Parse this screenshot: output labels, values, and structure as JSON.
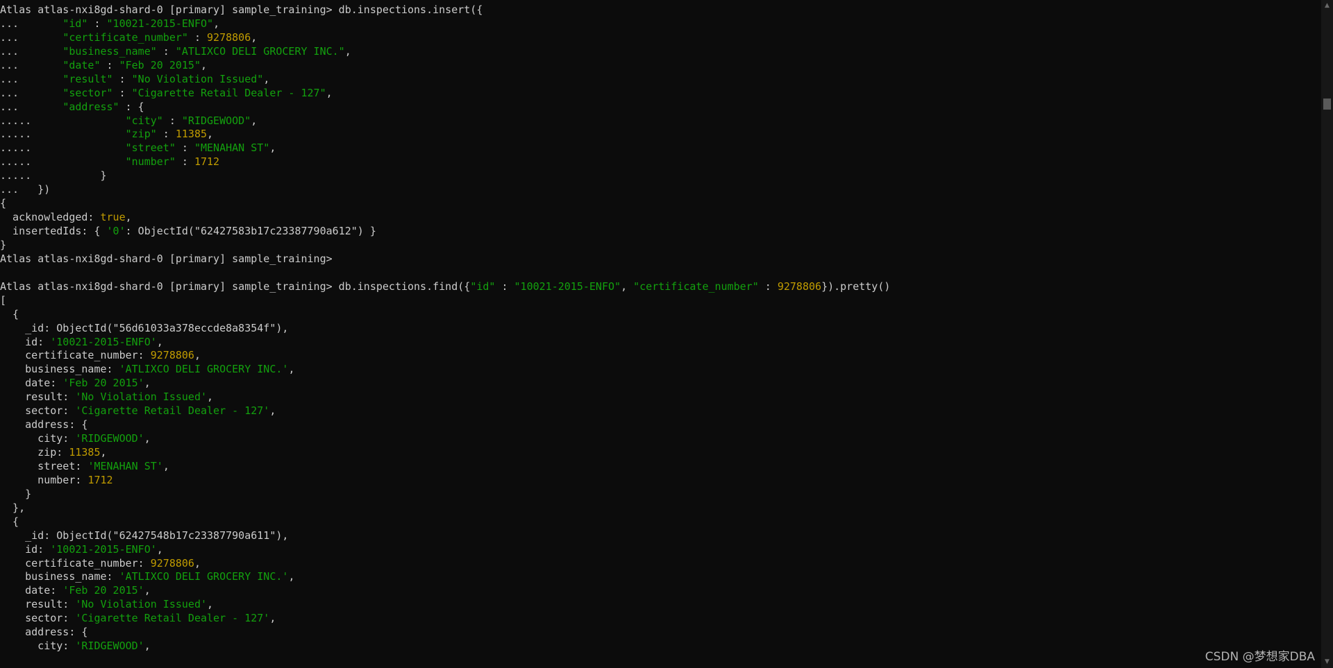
{
  "terminal": {
    "lines": [
      [
        {
          "t": "Atlas atlas-nxi8gd-shard-0 [primary] sample_training> db.inspections.insert({"
        }
      ],
      [
        {
          "t": "...       "
        },
        {
          "t": "\"id\"",
          "c": "s"
        },
        {
          "t": " : "
        },
        {
          "t": "\"10021-2015-ENFO\"",
          "c": "s"
        },
        {
          "t": ","
        }
      ],
      [
        {
          "t": "...       "
        },
        {
          "t": "\"certificate_number\"",
          "c": "s"
        },
        {
          "t": " : "
        },
        {
          "t": "9278806",
          "c": "n"
        },
        {
          "t": ","
        }
      ],
      [
        {
          "t": "...       "
        },
        {
          "t": "\"business_name\"",
          "c": "s"
        },
        {
          "t": " : "
        },
        {
          "t": "\"ATLIXCO DELI GROCERY INC.\"",
          "c": "s"
        },
        {
          "t": ","
        }
      ],
      [
        {
          "t": "...       "
        },
        {
          "t": "\"date\"",
          "c": "s"
        },
        {
          "t": " : "
        },
        {
          "t": "\"Feb 20 2015\"",
          "c": "s"
        },
        {
          "t": ","
        }
      ],
      [
        {
          "t": "...       "
        },
        {
          "t": "\"result\"",
          "c": "s"
        },
        {
          "t": " : "
        },
        {
          "t": "\"No Violation Issued\"",
          "c": "s"
        },
        {
          "t": ","
        }
      ],
      [
        {
          "t": "...       "
        },
        {
          "t": "\"sector\"",
          "c": "s"
        },
        {
          "t": " : "
        },
        {
          "t": "\"Cigarette Retail Dealer - 127\"",
          "c": "s"
        },
        {
          "t": ","
        }
      ],
      [
        {
          "t": "...       "
        },
        {
          "t": "\"address\"",
          "c": "s"
        },
        {
          "t": " : {"
        }
      ],
      [
        {
          "t": ".....               "
        },
        {
          "t": "\"city\"",
          "c": "s"
        },
        {
          "t": " : "
        },
        {
          "t": "\"RIDGEWOOD\"",
          "c": "s"
        },
        {
          "t": ","
        }
      ],
      [
        {
          "t": ".....               "
        },
        {
          "t": "\"zip\"",
          "c": "s"
        },
        {
          "t": " : "
        },
        {
          "t": "11385",
          "c": "n"
        },
        {
          "t": ","
        }
      ],
      [
        {
          "t": ".....               "
        },
        {
          "t": "\"street\"",
          "c": "s"
        },
        {
          "t": " : "
        },
        {
          "t": "\"MENAHAN ST\"",
          "c": "s"
        },
        {
          "t": ","
        }
      ],
      [
        {
          "t": ".....               "
        },
        {
          "t": "\"number\"",
          "c": "s"
        },
        {
          "t": " : "
        },
        {
          "t": "1712",
          "c": "n"
        }
      ],
      [
        {
          "t": ".....           }"
        }
      ],
      [
        {
          "t": "...   })"
        }
      ],
      [
        {
          "t": "{"
        }
      ],
      [
        {
          "t": "  acknowledged: "
        },
        {
          "t": "true",
          "c": "n"
        },
        {
          "t": ","
        }
      ],
      [
        {
          "t": "  insertedIds: { "
        },
        {
          "t": "'0'",
          "c": "s"
        },
        {
          "t": ": ObjectId(\"62427583b17c23387790a612\") }"
        }
      ],
      [
        {
          "t": "}"
        }
      ],
      [
        {
          "t": "Atlas atlas-nxi8gd-shard-0 [primary] sample_training>"
        }
      ],
      [
        {
          "t": ""
        }
      ],
      [
        {
          "t": "Atlas atlas-nxi8gd-shard-0 [primary] sample_training> db.inspections.find({"
        },
        {
          "t": "\"id\"",
          "c": "s"
        },
        {
          "t": " : "
        },
        {
          "t": "\"10021-2015-ENFO\"",
          "c": "s"
        },
        {
          "t": ", "
        },
        {
          "t": "\"certificate_number\"",
          "c": "s"
        },
        {
          "t": " : "
        },
        {
          "t": "9278806",
          "c": "n"
        },
        {
          "t": "}).pretty()"
        }
      ],
      [
        {
          "t": "["
        }
      ],
      [
        {
          "t": "  {"
        }
      ],
      [
        {
          "t": "    _id: ObjectId(\"56d61033a378eccde8a8354f\"),"
        }
      ],
      [
        {
          "t": "    id: "
        },
        {
          "t": "'10021-2015-ENFO'",
          "c": "s"
        },
        {
          "t": ","
        }
      ],
      [
        {
          "t": "    certificate_number: "
        },
        {
          "t": "9278806",
          "c": "n"
        },
        {
          "t": ","
        }
      ],
      [
        {
          "t": "    business_name: "
        },
        {
          "t": "'ATLIXCO DELI GROCERY INC.'",
          "c": "s"
        },
        {
          "t": ","
        }
      ],
      [
        {
          "t": "    date: "
        },
        {
          "t": "'Feb 20 2015'",
          "c": "s"
        },
        {
          "t": ","
        }
      ],
      [
        {
          "t": "    result: "
        },
        {
          "t": "'No Violation Issued'",
          "c": "s"
        },
        {
          "t": ","
        }
      ],
      [
        {
          "t": "    sector: "
        },
        {
          "t": "'Cigarette Retail Dealer - 127'",
          "c": "s"
        },
        {
          "t": ","
        }
      ],
      [
        {
          "t": "    address: {"
        }
      ],
      [
        {
          "t": "      city: "
        },
        {
          "t": "'RIDGEWOOD'",
          "c": "s"
        },
        {
          "t": ","
        }
      ],
      [
        {
          "t": "      zip: "
        },
        {
          "t": "11385",
          "c": "n"
        },
        {
          "t": ","
        }
      ],
      [
        {
          "t": "      street: "
        },
        {
          "t": "'MENAHAN ST'",
          "c": "s"
        },
        {
          "t": ","
        }
      ],
      [
        {
          "t": "      number: "
        },
        {
          "t": "1712",
          "c": "n"
        }
      ],
      [
        {
          "t": "    }"
        }
      ],
      [
        {
          "t": "  },"
        }
      ],
      [
        {
          "t": "  {"
        }
      ],
      [
        {
          "t": "    _id: ObjectId(\"62427548b17c23387790a611\"),"
        }
      ],
      [
        {
          "t": "    id: "
        },
        {
          "t": "'10021-2015-ENFO'",
          "c": "s"
        },
        {
          "t": ","
        }
      ],
      [
        {
          "t": "    certificate_number: "
        },
        {
          "t": "9278806",
          "c": "n"
        },
        {
          "t": ","
        }
      ],
      [
        {
          "t": "    business_name: "
        },
        {
          "t": "'ATLIXCO DELI GROCERY INC.'",
          "c": "s"
        },
        {
          "t": ","
        }
      ],
      [
        {
          "t": "    date: "
        },
        {
          "t": "'Feb 20 2015'",
          "c": "s"
        },
        {
          "t": ","
        }
      ],
      [
        {
          "t": "    result: "
        },
        {
          "t": "'No Violation Issued'",
          "c": "s"
        },
        {
          "t": ","
        }
      ],
      [
        {
          "t": "    sector: "
        },
        {
          "t": "'Cigarette Retail Dealer - 127'",
          "c": "s"
        },
        {
          "t": ","
        }
      ],
      [
        {
          "t": "    address: {"
        }
      ],
      [
        {
          "t": "      city: "
        },
        {
          "t": "'RIDGEWOOD'",
          "c": "s"
        },
        {
          "t": ","
        }
      ]
    ]
  },
  "scrollbar": {
    "up_glyph": "▲",
    "down_glyph": "▼"
  },
  "watermark": {
    "text": "CSDN @梦想家DBA"
  },
  "colors": {
    "background": "#0c0c0c",
    "text": "#cccccc",
    "string": "#13a10e",
    "number": "#c19c00"
  }
}
